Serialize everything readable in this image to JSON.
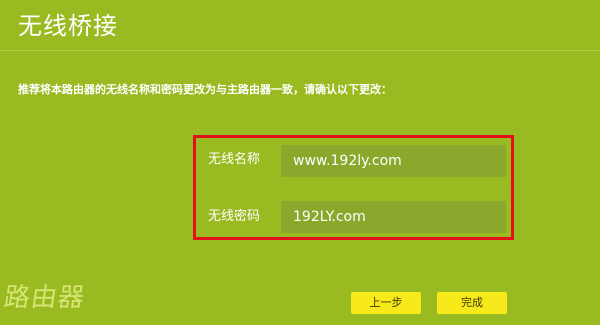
{
  "page": {
    "title": "无线桥接",
    "instruction": "推荐将本路由器的无线名称和密码更改为与主路由器一致，请确认以下更改："
  },
  "form": {
    "ssid_label": "无线名称",
    "ssid_value": "www.192ly.com",
    "password_label": "无线密码",
    "password_value": "192LY.com"
  },
  "buttons": {
    "prev_label": "上一步",
    "done_label": "完成"
  },
  "watermark": {
    "text": "路由器"
  },
  "colors": {
    "background": "#99bb21",
    "input_background": "#8aa82b",
    "highlight_border": "#e0111a",
    "button_background": "#f7e91a"
  }
}
